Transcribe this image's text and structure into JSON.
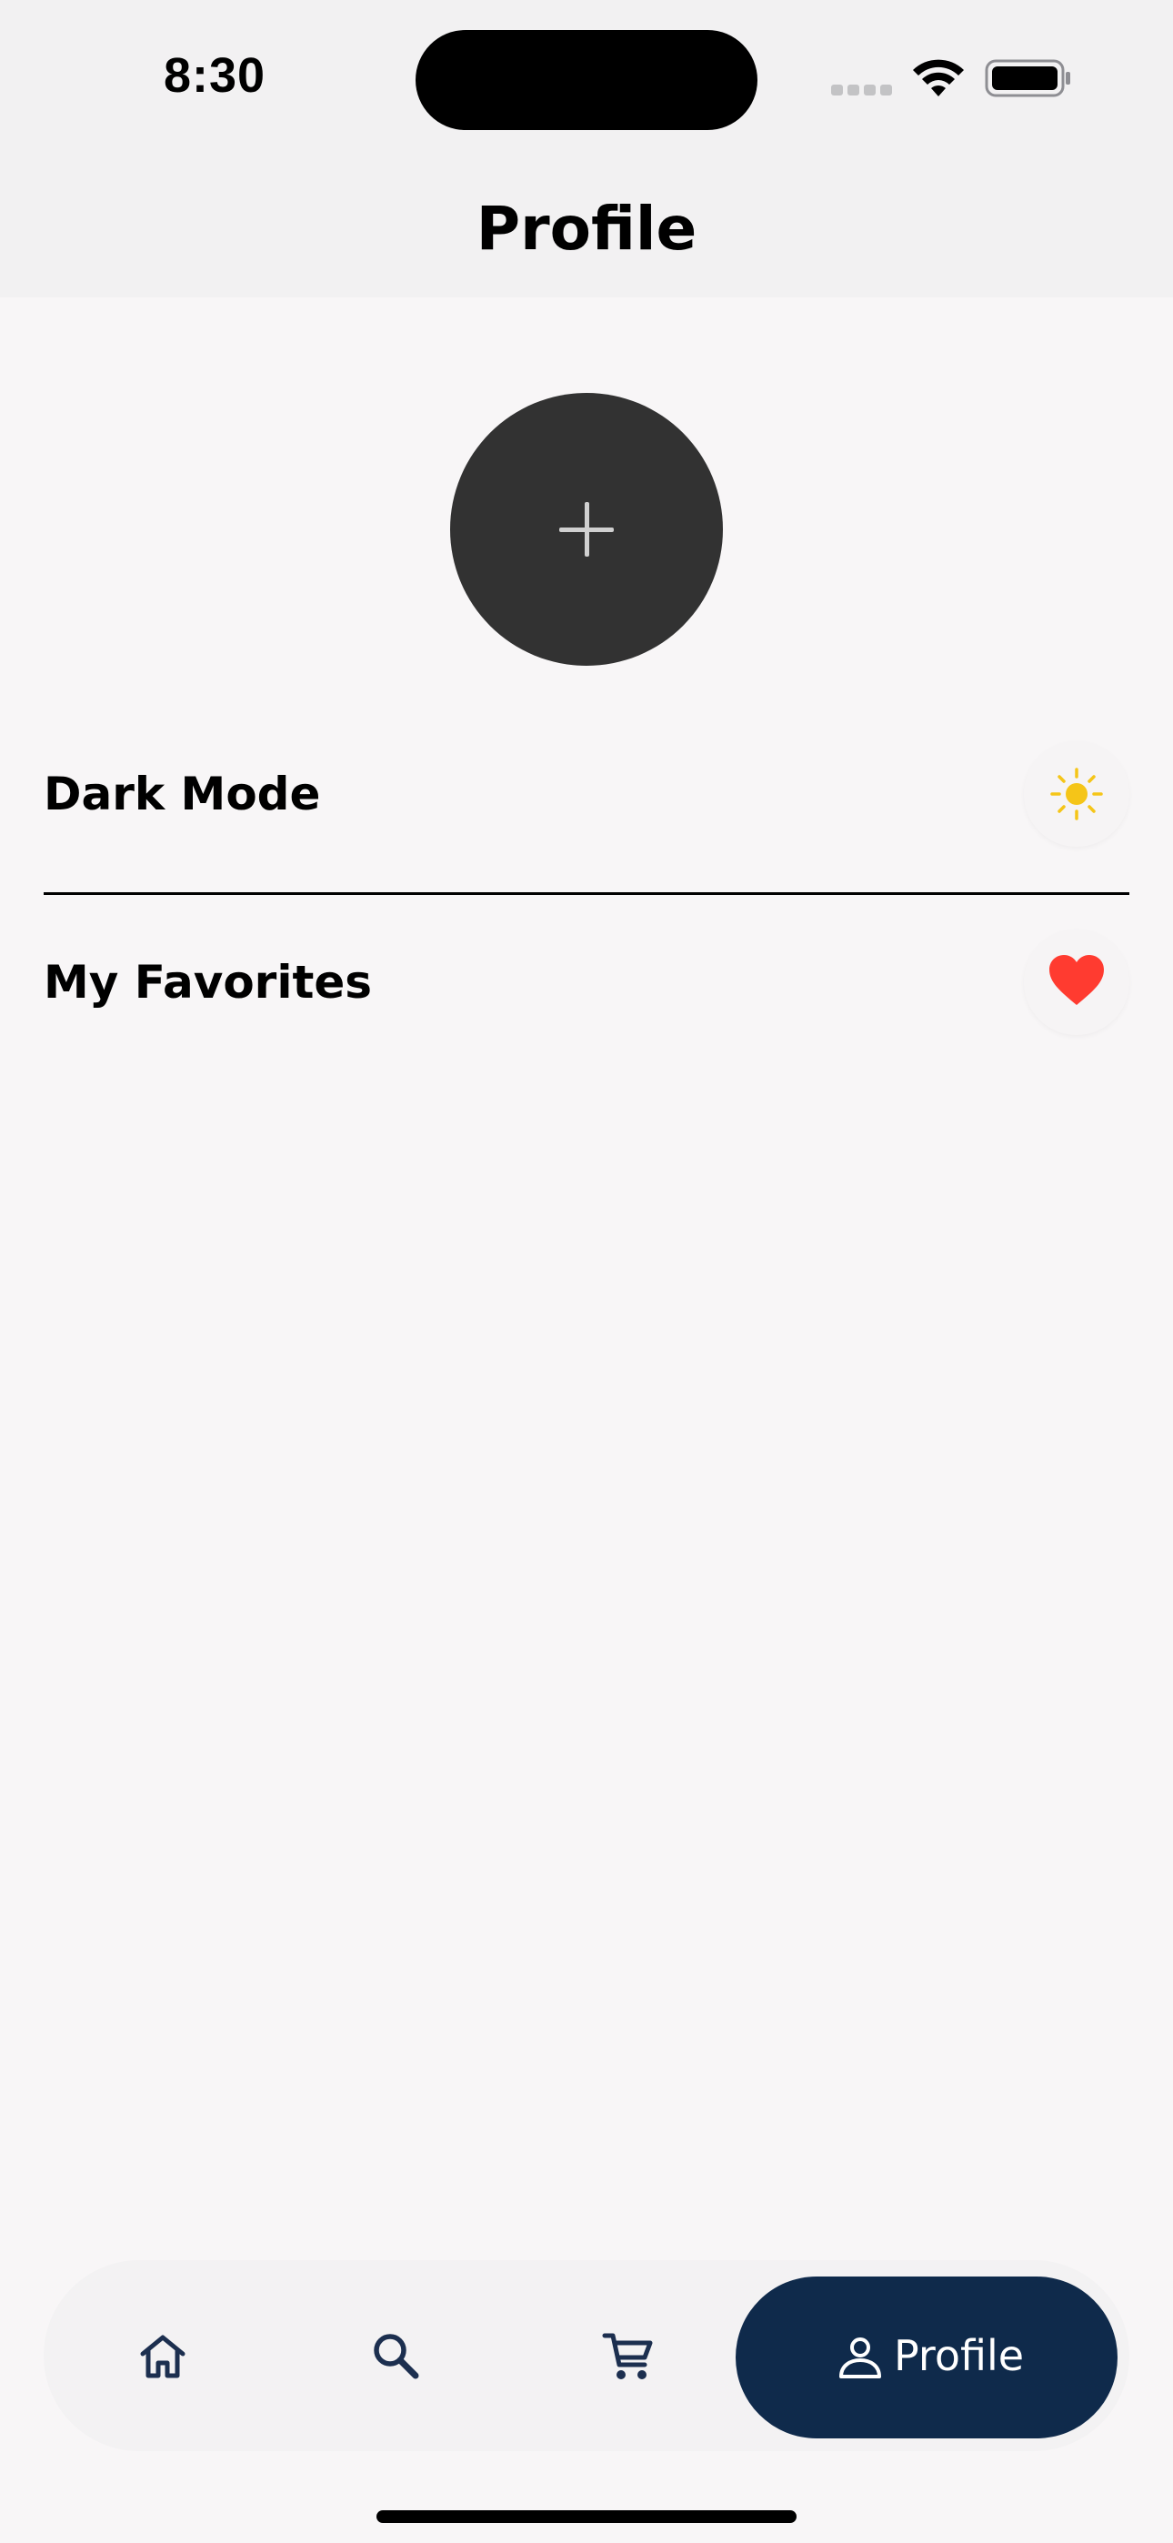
{
  "status_bar": {
    "time": "8:30",
    "icons": [
      "signal-icon",
      "wifi-icon",
      "battery-icon"
    ]
  },
  "header": {
    "title": "Profile"
  },
  "avatar": {
    "icon": "plus-icon"
  },
  "settings": [
    {
      "label": "Dark Mode",
      "icon": "sun-icon",
      "icon_color": "#f5c518"
    },
    {
      "label": "My Favorites",
      "icon": "heart-icon",
      "icon_color": "#ff3b30"
    }
  ],
  "bottom_nav": {
    "items": [
      {
        "icon": "home-icon"
      },
      {
        "icon": "search-icon"
      },
      {
        "icon": "cart-icon"
      },
      {
        "icon": "person-icon",
        "label": "Profile",
        "active": true
      }
    ],
    "active_color": "#0f2a4b",
    "icon_color": "#1c2f4f"
  }
}
